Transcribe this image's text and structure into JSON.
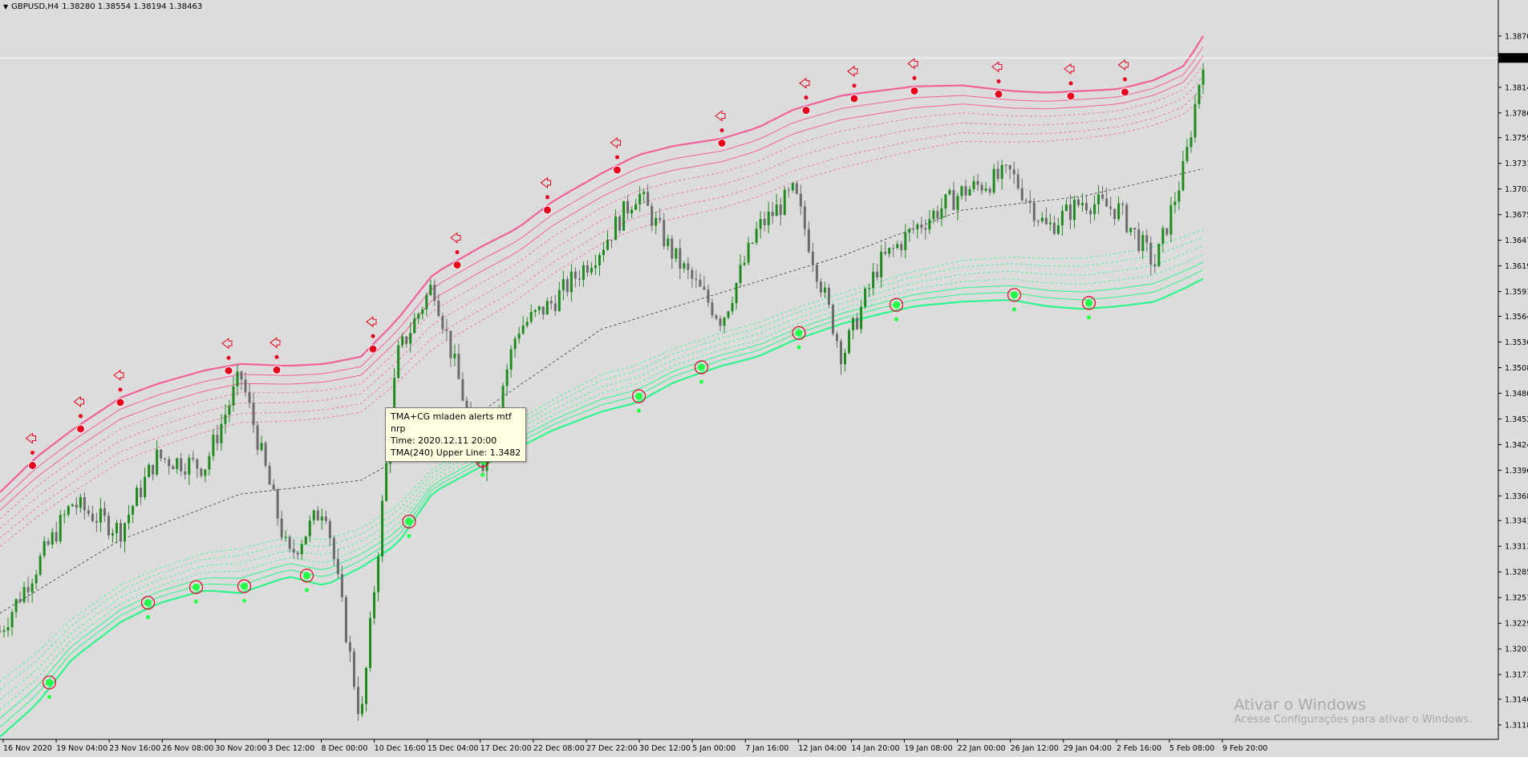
{
  "header": {
    "menu_icon": "triangle-down-icon",
    "symbol": "GBPUSD,H4",
    "ohlc": "1.38280 1.38554 1.38194 1.38463"
  },
  "current_price_label": "1.3846",
  "tooltip": {
    "line1": "TMA+CG mladen alerts mtf",
    "line2": "nrp",
    "line3": "Time: 2020.12.11 20:00",
    "line4": "TMA(240) Upper Line: 1.3482"
  },
  "watermark": {
    "line1": "Ativar o Windows",
    "line2": "Acesse Configurações para ativar o Windows."
  },
  "colors": {
    "background": "#dcdcdc",
    "bull_candle": "#1f8a1f",
    "bear_candle": "#6b6b6b",
    "upper_band": "#f2609a",
    "lower_band": "#2ef58a",
    "mid_line": "#303030",
    "sell_signal": "#e8001c",
    "buy_signal": "#22ff44"
  },
  "chart_data": {
    "type": "line",
    "title": "",
    "xlabel": "",
    "ylabel": "",
    "ylim": [
      1.3104,
      1.3897
    ],
    "y_ticks": [
      "1.3870",
      "1.3814",
      "1.3786",
      "1.3759",
      "1.3731",
      "1.3703",
      "1.3675",
      "1.3647",
      "1.3619",
      "1.3591",
      "1.3564",
      "1.3536",
      "1.3508",
      "1.3480",
      "1.3452",
      "1.3424",
      "1.3396",
      "1.3368",
      "1.3341",
      "1.3313",
      "1.3285",
      "1.3257",
      "1.3229",
      "1.3201",
      "1.3173",
      "1.3146",
      "1.3118"
    ],
    "x_ticks": [
      "16 Nov 2020",
      "19 Nov 04:00",
      "23 Nov 16:00",
      "26 Nov 08:00",
      "30 Nov 20:00",
      "3 Dec 12:00",
      "8 Dec 00:00",
      "10 Dec 16:00",
      "15 Dec 04:00",
      "17 Dec 20:00",
      "22 Dec 08:00",
      "27 Dec 22:00",
      "30 Dec 12:00",
      "5 Jan 00:00",
      "7 Jan 16:00",
      "12 Jan 04:00",
      "14 Jan 20:00",
      "19 Jan 08:00",
      "22 Jan 00:00",
      "26 Jan 12:00",
      "29 Jan 04:00",
      "2 Feb 16:00",
      "5 Feb 08:00",
      "9 Feb 20:00"
    ],
    "grid": false,
    "series": [
      {
        "role": "close",
        "x": [
          0,
          0.03,
          0.06,
          0.1,
          0.13,
          0.17,
          0.2,
          0.24,
          0.27,
          0.3,
          0.33,
          0.36,
          0.4,
          0.43,
          0.46,
          0.5,
          0.53,
          0.56,
          0.6,
          0.63,
          0.66,
          0.7,
          0.73,
          0.76,
          0.8,
          0.84,
          0.87,
          0.9,
          0.93,
          0.96,
          0.985,
          1.0
        ],
        "values": [
          1.322,
          1.329,
          1.336,
          1.333,
          1.341,
          1.34,
          1.35,
          1.33,
          1.336,
          1.312,
          1.352,
          1.36,
          1.34,
          1.355,
          1.358,
          1.364,
          1.37,
          1.363,
          1.356,
          1.366,
          1.37,
          1.352,
          1.362,
          1.366,
          1.37,
          1.372,
          1.366,
          1.369,
          1.368,
          1.362,
          1.373,
          1.3846
        ]
      },
      {
        "role": "upper",
        "x": [
          0,
          0.03,
          0.06,
          0.1,
          0.13,
          0.17,
          0.2,
          0.24,
          0.27,
          0.3,
          0.33,
          0.36,
          0.4,
          0.43,
          0.46,
          0.5,
          0.53,
          0.56,
          0.6,
          0.63,
          0.66,
          0.7,
          0.73,
          0.76,
          0.8,
          0.84,
          0.87,
          0.9,
          0.93,
          0.96,
          0.985,
          1.0
        ],
        "values": [
          1.3372,
          1.341,
          1.344,
          1.3475,
          1.349,
          1.3505,
          1.3512,
          1.351,
          1.3512,
          1.352,
          1.356,
          1.361,
          1.364,
          1.366,
          1.369,
          1.372,
          1.374,
          1.375,
          1.3758,
          1.377,
          1.379,
          1.3805,
          1.381,
          1.3815,
          1.3816,
          1.381,
          1.3808,
          1.381,
          1.3812,
          1.3822,
          1.3838,
          1.387
        ]
      },
      {
        "role": "middle",
        "x": [
          0,
          0.1,
          0.2,
          0.3,
          0.4,
          0.5,
          0.6,
          0.7,
          0.8,
          0.9,
          1.0
        ],
        "values": [
          1.324,
          1.332,
          1.337,
          1.3385,
          1.346,
          1.355,
          1.359,
          1.363,
          1.368,
          1.3695,
          1.3725
        ]
      },
      {
        "role": "lower",
        "x": [
          0,
          0.03,
          0.06,
          0.1,
          0.13,
          0.17,
          0.2,
          0.24,
          0.27,
          0.3,
          0.33,
          0.36,
          0.4,
          0.43,
          0.46,
          0.5,
          0.53,
          0.56,
          0.6,
          0.63,
          0.66,
          0.7,
          0.73,
          0.76,
          0.8,
          0.84,
          0.87,
          0.9,
          0.93,
          0.96,
          0.985,
          1.0
        ],
        "values": [
          1.3105,
          1.314,
          1.319,
          1.323,
          1.325,
          1.3265,
          1.3262,
          1.328,
          1.327,
          1.329,
          1.3315,
          1.3372,
          1.34,
          1.342,
          1.344,
          1.346,
          1.347,
          1.3492,
          1.351,
          1.352,
          1.3538,
          1.3556,
          1.3566,
          1.3575,
          1.358,
          1.3582,
          1.3575,
          1.3572,
          1.3575,
          1.358,
          1.3595,
          1.3605
        ]
      }
    ]
  }
}
